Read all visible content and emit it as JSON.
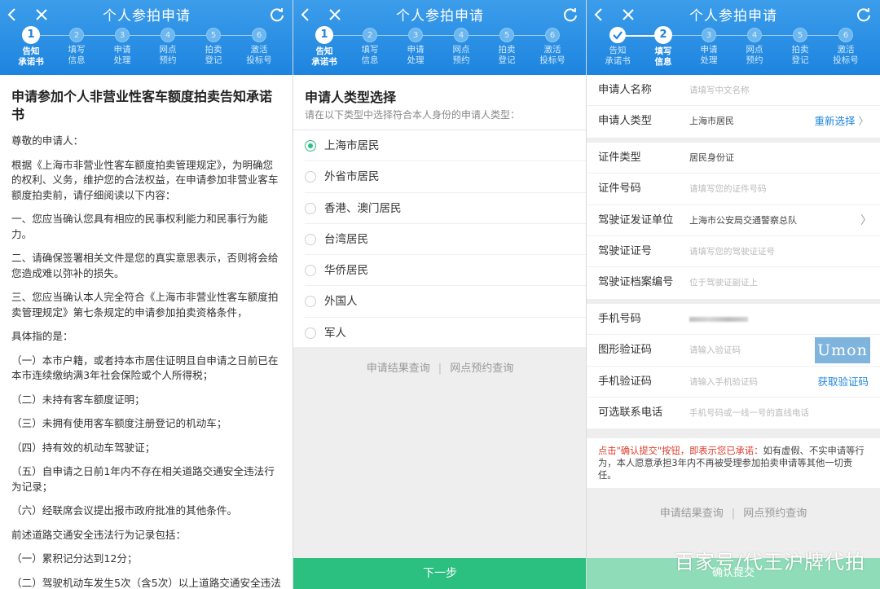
{
  "header": {
    "title": "个人参拍申请"
  },
  "steps": [
    {
      "num": "1",
      "label1": "告知",
      "label2": "承诺书"
    },
    {
      "num": "2",
      "label1": "填写",
      "label2": "信息"
    },
    {
      "num": "3",
      "label1": "申请",
      "label2": "处理"
    },
    {
      "num": "4",
      "label1": "网点",
      "label2": "预约"
    },
    {
      "num": "5",
      "label1": "拍卖",
      "label2": "登记"
    },
    {
      "num": "6",
      "label1": "激活",
      "label2": "投标号"
    }
  ],
  "agreement": {
    "title": "申请参加个人非营业性客车额度拍卖告知承诺书",
    "paragraphs": [
      "尊敬的申请人：",
      "根据《上海市非营业性客车额度拍卖管理规定》，为明确您的权利、义务，维护您的合法权益，在申请参加非营业客车额度拍卖前，请仔细阅读以下内容：",
      "一、您应当确认您具有相应的民事权利能力和民事行为能力。",
      "二、请确保签署相关文件是您的真实意思表示，否则将会给您造成难以弥补的损失。",
      "三、您应当确认本人完全符合《上海市非营业性客车额度拍卖管理规定》第七条规定的申请参加拍卖资格条件，",
      "具体指的是：",
      "（一）本市户籍，或者持本市居住证明且自申请之日前已在本市连续缴纳满3年社会保险或个人所得税；",
      "（二）未持有客车额度证明；",
      "（三）未拥有使用客车额度注册登记的机动车；",
      "（四）持有效的机动车驾驶证；",
      "（五）自申请之日前1年内不存在相关道路交通安全违法行为记录；",
      "（六）经联席会议提出报市政府批准的其他条件。",
      "前述道路交通安全违法行为记录包括：",
      "（一）累积记分达到12分；",
      "（二）驾驶机动车发生5次（含5次）以上道路交通安全违法行为；"
    ]
  },
  "type_select": {
    "title": "申请人类型选择",
    "subtitle": "请在以下类型中选择符合本人身份的申请人类型：",
    "options": [
      "上海市居民",
      "外省市居民",
      "香港、澳门居民",
      "台湾居民",
      "华侨居民",
      "外国人",
      "军人"
    ],
    "selected": "上海市居民"
  },
  "links": {
    "result_query": "申请结果查询",
    "appointment_query": "网点预约查询"
  },
  "next_button": "下一步",
  "form": {
    "name_label": "申请人名称",
    "name_placeholder": "请填写中文名称",
    "type_label": "申请人类型",
    "type_value": "上海市居民",
    "reselect": "重新选择",
    "id_type_label": "证件类型",
    "id_type_value": "居民身份证",
    "id_no_label": "证件号码",
    "id_no_placeholder": "请填写您的证件号码",
    "issuer_label": "驾驶证发证单位",
    "issuer_value": "上海市公安局交通警察总队",
    "license_no_label": "驾驶证证号",
    "license_no_placeholder": "请填写您的驾驶证证号",
    "archive_label": "驾驶证档案编号",
    "archive_placeholder": "位于驾驶证副证上",
    "phone_label": "手机号码",
    "captcha_label": "图形验证码",
    "captcha_placeholder": "请输入验证码",
    "captcha_text": "Umon",
    "sms_label": "手机验证码",
    "sms_placeholder": "请输入手机验证码",
    "get_code": "获取验证码",
    "alt_phone_label": "可选联系电话",
    "alt_phone_placeholder": "手机号码或一线一号的直线电话"
  },
  "notice": {
    "red": "点击\"确认提交\"按钮，即表示您已承诺：",
    "text": "如有虚假、不实申请等行为，本人愿意承担3年内不再被受理参加拍卖申请等其他一切责任。"
  },
  "submit_button": "确认提交",
  "watermark": "百家号/代王沪牌代拍",
  "colors": {
    "header": "#1d84df",
    "green": "#2bbf80",
    "link": "#1d84df",
    "warn": "#e03b2a"
  }
}
